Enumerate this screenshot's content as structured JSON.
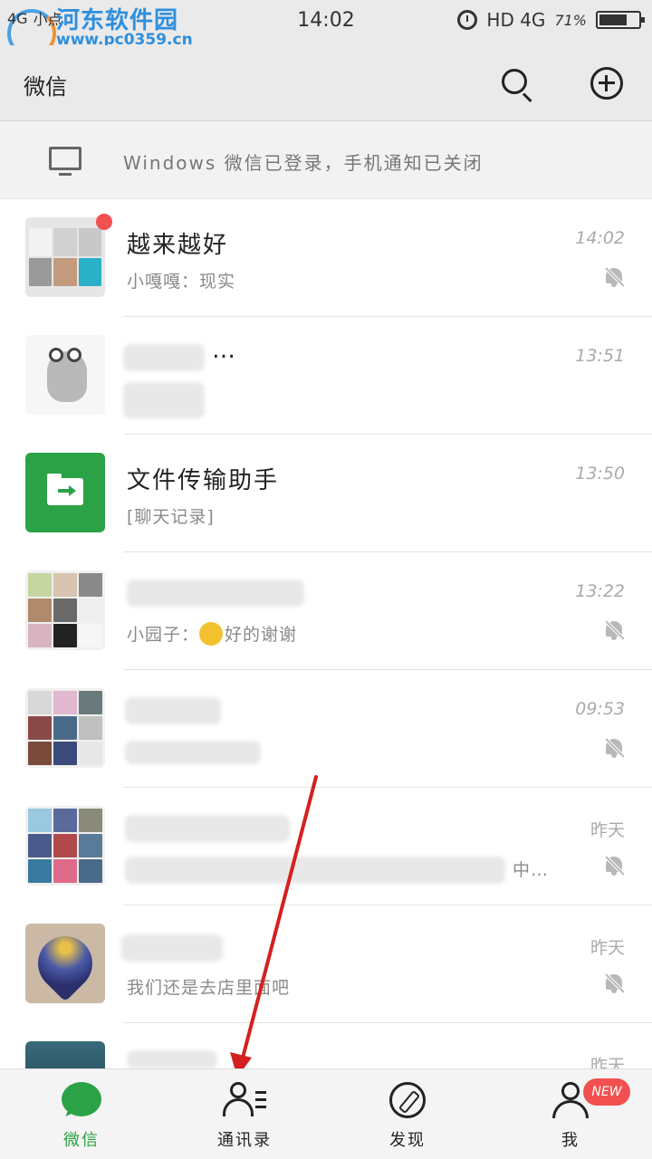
{
  "status_bar": {
    "left_text": "4G",
    "carrier": "小点",
    "watermark": "河东软件园",
    "watermark_url": "www.pc0359.cn",
    "time": "14:02",
    "network": "HD 4G",
    "battery": "71%",
    "battery_level": 0.71
  },
  "header": {
    "title": "微信",
    "search_icon": "search-icon",
    "add_icon": "plus-circle-icon"
  },
  "notice": {
    "text": "Windows 微信已登录，手机通知已关闭"
  },
  "chats": [
    {
      "name": "越来越好",
      "preview": "小嘎嘎：现实",
      "time": "14:02",
      "muted": true,
      "unread": true
    },
    {
      "name": "…",
      "preview": "",
      "time": "13:51",
      "muted": false,
      "unread": false
    },
    {
      "name": "文件传输助手",
      "preview": "[聊天记录]",
      "time": "13:50",
      "muted": false,
      "unread": false
    },
    {
      "name": "",
      "preview_prefix": "小园子：",
      "preview_suffix": "好的谢谢",
      "time": "13:22",
      "muted": true,
      "unread": false
    },
    {
      "name": "",
      "preview": "",
      "time": "09:53",
      "muted": true,
      "unread": false
    },
    {
      "name": "",
      "preview": "中…",
      "time": "昨天",
      "muted": true,
      "unread": false
    },
    {
      "name": "",
      "preview": "我们还是去店里面吧",
      "time": "昨天",
      "muted": true,
      "unread": false
    },
    {
      "name": "",
      "preview": "",
      "time": "昨天",
      "muted": false,
      "unread": false
    }
  ],
  "tabs": [
    {
      "label": "微信",
      "icon": "chat-bubble-icon",
      "active": true
    },
    {
      "label": "通讯录",
      "icon": "contacts-icon",
      "active": false
    },
    {
      "label": "发现",
      "icon": "compass-icon",
      "active": false
    },
    {
      "label": "我",
      "icon": "person-icon",
      "active": false,
      "badge": "NEW"
    }
  ],
  "colors": {
    "accent_green": "#2ba245",
    "badge_red": "#f25050",
    "annotation_red": "#d42020"
  }
}
